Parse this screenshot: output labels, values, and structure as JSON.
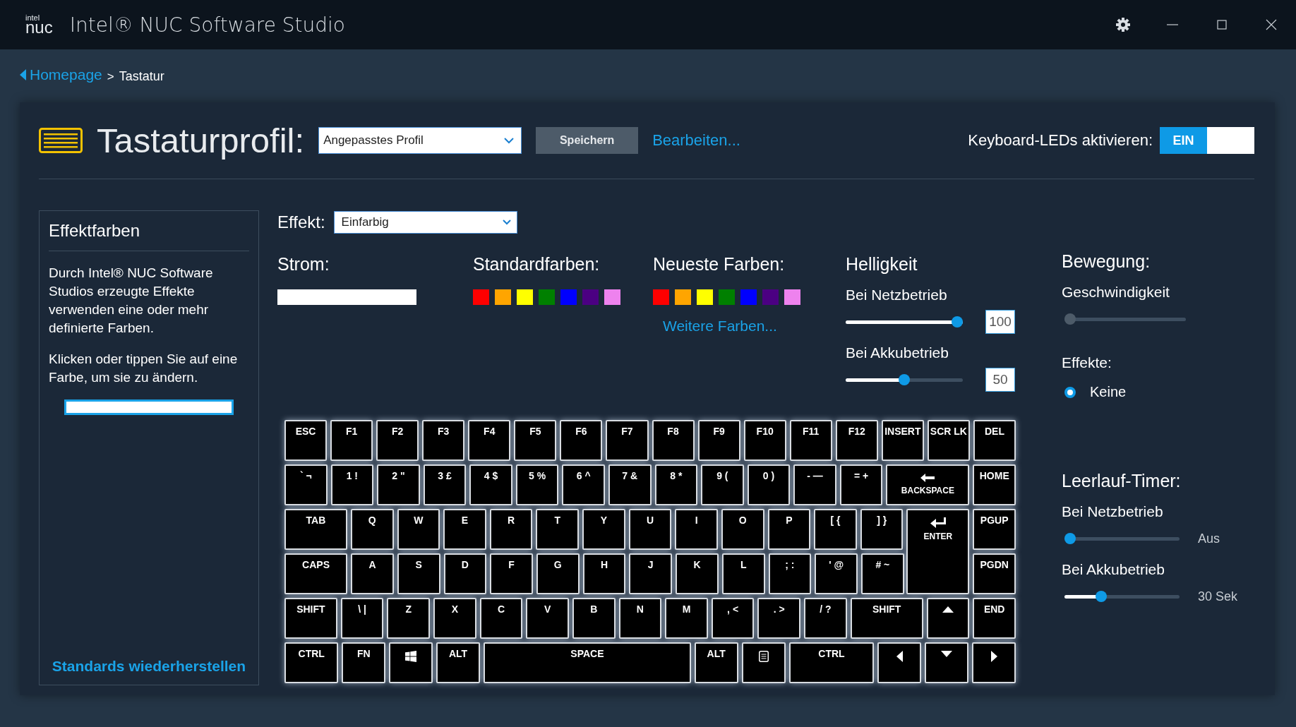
{
  "window": {
    "logo_small": "intel",
    "logo": "nuc",
    "title": "Intel® NUC Software Studio"
  },
  "breadcrumb": {
    "link": "Homepage",
    "separator": ">",
    "current": "Tastatur"
  },
  "profile": {
    "title": "Tastaturprofil:",
    "dropdown": "Angepasstes Profil",
    "save": "Speichern",
    "edit": "Bearbeiten...",
    "leds_label": "Keyboard-LEDs aktivieren:",
    "leds_on": true,
    "leds_on_text": "EIN"
  },
  "effect_colors": {
    "title": "Effektfarben",
    "paragraphs": [
      "Durch Intel® NUC Software Studios erzeugte Effekte verwenden eine oder mehr definierte Farben.",
      "Klicken oder tippen Sie auf eine Farbe, um sie zu ändern."
    ],
    "slots": [
      {
        "color": "#ffffff",
        "selected": true
      }
    ],
    "reset": "Standards wiederherstellen"
  },
  "effect": {
    "label": "Effekt:",
    "value": "Einfarbig"
  },
  "power": {
    "label": "Strom:",
    "color": "#ffffff"
  },
  "standard_colors": {
    "label": "Standardfarben:",
    "colors": [
      {
        "color": "#ff0000"
      },
      {
        "color": "#ffa500"
      },
      {
        "color": "#ffff00"
      },
      {
        "color": "#008000"
      },
      {
        "color": "#0000ff"
      },
      {
        "color": "#4b0082"
      },
      {
        "color": "#ee82ee"
      }
    ]
  },
  "recent_colors": {
    "label": "Neueste Farben:",
    "colors": [
      {
        "color": "#ff0000"
      },
      {
        "color": "#ffa500"
      },
      {
        "color": "#ffff00"
      },
      {
        "color": "#008000"
      },
      {
        "color": "#0000ff"
      },
      {
        "color": "#4b0082"
      },
      {
        "color": "#ee82ee"
      }
    ],
    "more": "Weitere Farben..."
  },
  "brightness": {
    "title": "Helligkeit",
    "sliders": [
      {
        "label": "Bei Netzbetrieb",
        "level": 1.0,
        "value": "100"
      },
      {
        "label": "Bei Akkubetrieb",
        "level": 0.5,
        "value": "50"
      }
    ]
  },
  "motion": {
    "title": "Bewegung:",
    "speed_label": "Geschwindigkeit",
    "speed": {
      "level": 0,
      "disabled": true
    },
    "effects_label": "Effekte:",
    "effects": [
      {
        "label": "Keine",
        "selected": true
      }
    ]
  },
  "idle_timer": {
    "title": "Leerlauf-Timer:",
    "sliders": [
      {
        "label": "Bei Netzbetrieb",
        "level": 0,
        "value": "Aus"
      },
      {
        "label": "Bei Akkubetrieb",
        "level": 0.3,
        "value": "30 Sek"
      }
    ]
  },
  "keyboard": {
    "rows": [
      {
        "keys": [
          {
            "label": "ESC"
          },
          {
            "label": "F1"
          },
          {
            "label": "F2"
          },
          {
            "label": "F3"
          },
          {
            "label": "F4"
          },
          {
            "label": "F5"
          },
          {
            "label": "F6"
          },
          {
            "label": "F7"
          },
          {
            "label": "F8"
          },
          {
            "label": "F9"
          },
          {
            "label": "F10"
          },
          {
            "label": "F11"
          },
          {
            "label": "F12"
          },
          {
            "label": "INSERT"
          },
          {
            "label": "SCR LK"
          },
          {
            "label": "DEL"
          }
        ]
      },
      {
        "keys": [
          {
            "label": "` ¬"
          },
          {
            "label": "1 !"
          },
          {
            "label": "2 \""
          },
          {
            "label": "3 £"
          },
          {
            "label": "4 $"
          },
          {
            "label": "5 %"
          },
          {
            "label": "6 ^"
          },
          {
            "label": "7 &"
          },
          {
            "label": "8 *"
          },
          {
            "label": "9 ("
          },
          {
            "label": "0 )"
          },
          {
            "label": "- —"
          },
          {
            "label": "= +"
          },
          {
            "label": "BACKSPACE",
            "kind": "backspace"
          },
          {
            "label": "HOME"
          }
        ]
      },
      {
        "keys": [
          {
            "label": "TAB"
          },
          {
            "label": "Q"
          },
          {
            "label": "W"
          },
          {
            "label": "E"
          },
          {
            "label": "R"
          },
          {
            "label": "T"
          },
          {
            "label": "Y"
          },
          {
            "label": "U"
          },
          {
            "label": "I"
          },
          {
            "label": "O"
          },
          {
            "label": "P"
          },
          {
            "label": "[ {"
          },
          {
            "label": "] }"
          },
          {
            "label": "ENTER",
            "kind": "enter"
          },
          {
            "label": "PGUP"
          }
        ]
      },
      {
        "keys": [
          {
            "label": "CAPS"
          },
          {
            "label": "A"
          },
          {
            "label": "S"
          },
          {
            "label": "D"
          },
          {
            "label": "F"
          },
          {
            "label": "G"
          },
          {
            "label": "H"
          },
          {
            "label": "J"
          },
          {
            "label": "K"
          },
          {
            "label": "L"
          },
          {
            "label": "; :"
          },
          {
            "label": "' @"
          },
          {
            "label": "# ~"
          },
          {
            "kind": "covered"
          },
          {
            "label": "PGDN"
          }
        ]
      },
      {
        "keys": [
          {
            "label": "SHIFT"
          },
          {
            "label": "\\ |"
          },
          {
            "label": "Z"
          },
          {
            "label": "X"
          },
          {
            "label": "C"
          },
          {
            "label": "V"
          },
          {
            "label": "B"
          },
          {
            "label": "N"
          },
          {
            "label": "M"
          },
          {
            "label": ", <"
          },
          {
            "label": ". >"
          },
          {
            "label": "/ ?"
          },
          {
            "label": "SHIFT"
          },
          {
            "kind": "up"
          },
          {
            "label": "END"
          }
        ]
      },
      {
        "keys": [
          {
            "label": "CTRL"
          },
          {
            "label": "FN"
          },
          {
            "kind": "windows"
          },
          {
            "label": "ALT"
          },
          {
            "label": "SPACE"
          },
          {
            "label": "ALT"
          },
          {
            "kind": "menu"
          },
          {
            "label": "CTRL"
          },
          {
            "kind": "left"
          },
          {
            "kind": "down"
          },
          {
            "kind": "right"
          }
        ]
      }
    ]
  }
}
